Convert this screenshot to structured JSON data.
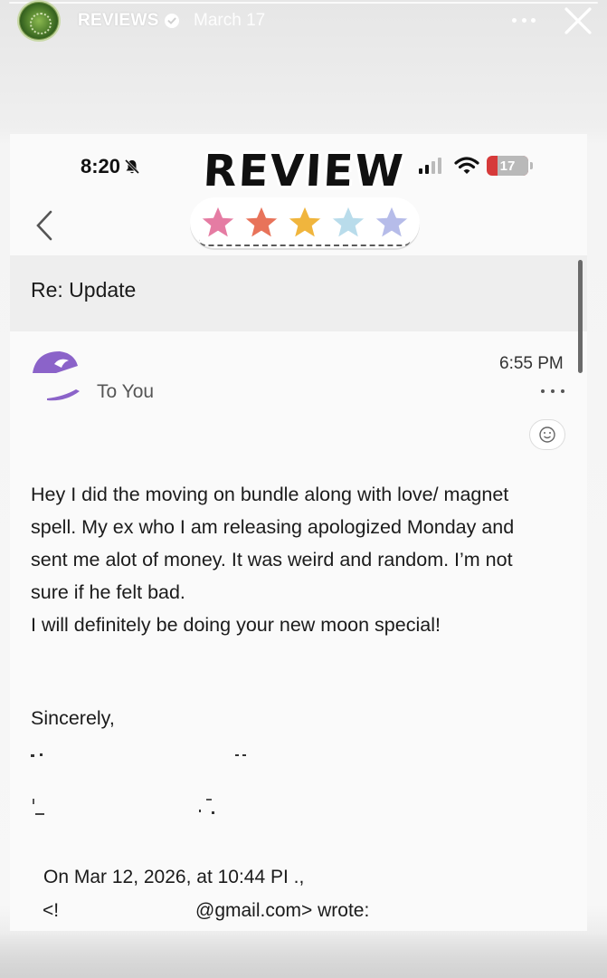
{
  "story": {
    "username": "REVIEWS",
    "date": "March 17"
  },
  "screenshot": {
    "status_time": "8:20",
    "battery_level": "17",
    "sticker_text": "REVIEW",
    "star_rating": 5,
    "star_colors": [
      "#e57ca3",
      "#e8735a",
      "#f0b53d",
      "#b9dceb",
      "#b6bce9"
    ],
    "email": {
      "subject": "Re: Update",
      "recipient": "To You",
      "time": "6:55 PM",
      "body_lines": [
        "Hey I did the moving on bundle along with love/ magnet",
        "spell. My ex who I am releasing apologized Monday and",
        "sent me alot of money. It was weird and random. I’m not",
        "sure if he felt bad.",
        "I will definitely be doing your new moon special!"
      ],
      "signoff": "Sincerely,",
      "quote_header": "On Mar 12, 2026, at 10:44 PI .,",
      "quote_prefix": "<!",
      "quote_email": "@gmail.com> wrote:"
    }
  },
  "colors": {
    "accent_purple": "#8b63c9",
    "battery_red": "#d63a3a"
  }
}
